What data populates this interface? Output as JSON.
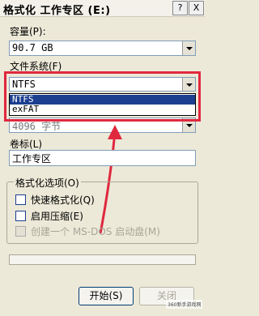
{
  "window": {
    "title": "格式化 工作专区 (E:)",
    "help_btn": "?",
    "close_btn": "X"
  },
  "capacity": {
    "label": "容量(P):",
    "value": "90.7 GB"
  },
  "filesystem": {
    "label": "文件系统(F)",
    "value": "NTFS",
    "options": [
      "NTFS",
      "exFAT"
    ],
    "selected_index": 0
  },
  "allocation": {
    "value": "4096 字节"
  },
  "volume": {
    "label": "卷标(L)",
    "value": "工作专区"
  },
  "format_options": {
    "title": "格式化选项(O)",
    "items": [
      {
        "label": "快速格式化(Q)",
        "checked": false,
        "enabled": true
      },
      {
        "label": "启用压缩(E)",
        "checked": false,
        "enabled": true
      },
      {
        "label": "创建一个 MS-DOS 启动盘(M)",
        "checked": false,
        "enabled": false
      }
    ]
  },
  "progress": {
    "value": 0
  },
  "buttons": {
    "start": "开始(S)",
    "close": "关闭"
  },
  "watermark": "360新手游戏网",
  "colors": {
    "highlight": "#e0283e",
    "selection": "#1c3f8f"
  }
}
